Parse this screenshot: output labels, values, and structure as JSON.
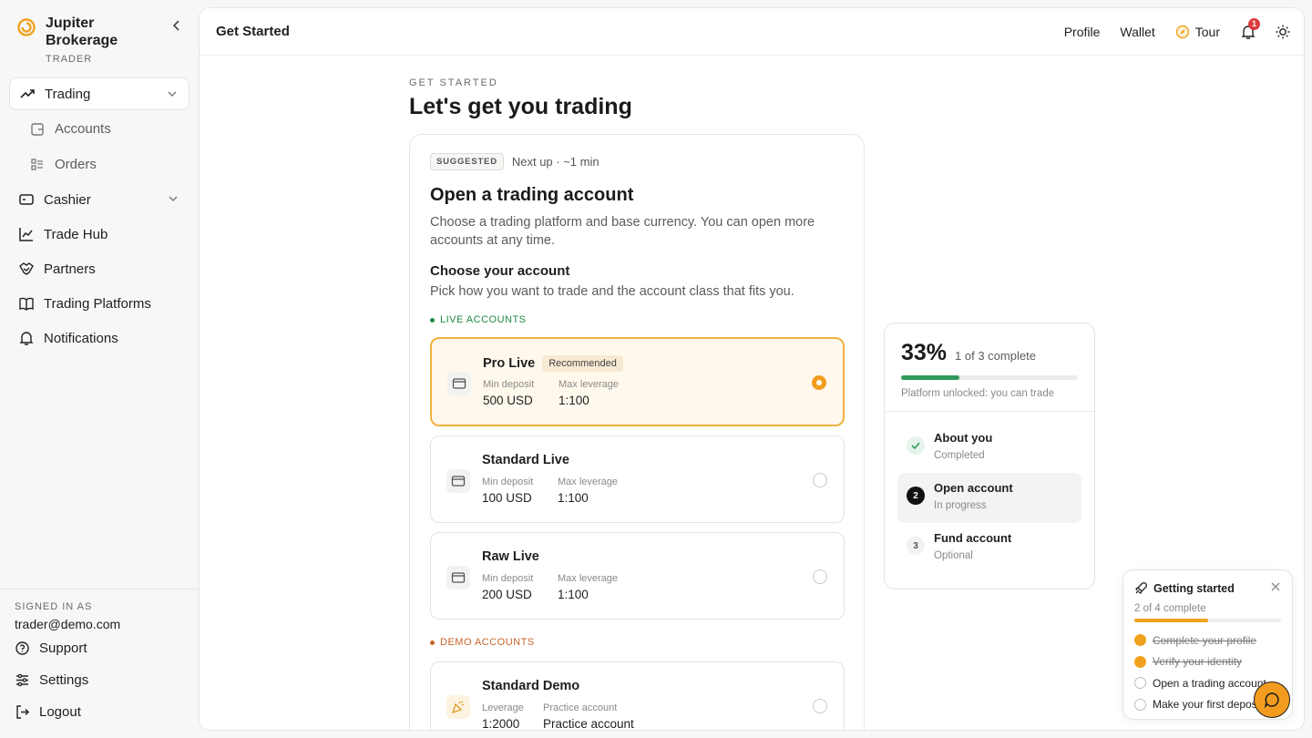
{
  "brand": {
    "name": "Jupiter Brokerage",
    "role": "TRADER"
  },
  "nav": {
    "trading": "Trading",
    "accounts": "Accounts",
    "orders": "Orders",
    "cashier": "Cashier",
    "trade_hub": "Trade Hub",
    "partners": "Partners",
    "trading_platforms": "Trading Platforms",
    "notifications": "Notifications"
  },
  "sidebar_footer": {
    "signed_in_label": "SIGNED IN AS",
    "email": "trader@demo.com",
    "support": "Support",
    "settings": "Settings",
    "logout": "Logout"
  },
  "topbar": {
    "title": "Get Started",
    "profile": "Profile",
    "wallet": "Wallet",
    "tour": "Tour",
    "notif_count": "1"
  },
  "page": {
    "eyebrow": "GET STARTED",
    "title": "Let's get you trading"
  },
  "card": {
    "badge": "SUGGESTED",
    "next_up": "Next up · ~1 min",
    "title": "Open a trading account",
    "description": "Choose a trading platform and base currency. You can open more accounts at any time.",
    "section_title": "Choose your account",
    "section_desc": "Pick how you want to trade and the account class that fits you.",
    "live_label": "LIVE ACCOUNTS",
    "demo_label": "DEMO ACCOUNTS",
    "live_accounts": [
      {
        "name": "Pro Live",
        "badge": "Recommended",
        "label_a": "Min deposit",
        "value_a": "500 USD",
        "label_b": "Max leverage",
        "value_b": "1:100",
        "selected": true
      },
      {
        "name": "Standard Live",
        "label_a": "Min deposit",
        "value_a": "100 USD",
        "label_b": "Max leverage",
        "value_b": "1:100",
        "selected": false
      },
      {
        "name": "Raw Live",
        "label_a": "Min deposit",
        "value_a": "200 USD",
        "label_b": "Max leverage",
        "value_b": "1:100",
        "selected": false
      }
    ],
    "demo_accounts": [
      {
        "name": "Standard Demo",
        "label_a": "Leverage",
        "value_a": "1:2000",
        "label_b": "Practice account",
        "value_b": "Practice account",
        "selected": false
      }
    ]
  },
  "progress": {
    "percent": "33%",
    "percent_value": 0.33,
    "summary": "1 of 3 complete",
    "note": "Platform unlocked: you can trade",
    "steps": [
      {
        "marker": "",
        "title": "About you",
        "status": "Completed"
      },
      {
        "marker": "2",
        "title": "Open account",
        "status": "In progress"
      },
      {
        "marker": "3",
        "title": "Fund account",
        "status": "Optional"
      }
    ]
  },
  "getting_started": {
    "title": "Getting started",
    "count": "2 of 4 complete",
    "progress_value": 0.5,
    "items": [
      {
        "label": "Complete your profile",
        "done": true
      },
      {
        "label": "Verify your identity",
        "done": true
      },
      {
        "label": "Open a trading account",
        "done": false
      },
      {
        "label": "Make your first deposit",
        "done": false
      }
    ]
  },
  "colors": {
    "accent": "#f29c1f",
    "success": "#2f9a5a",
    "live": "#1f8a47",
    "demo": "#c8642a"
  }
}
